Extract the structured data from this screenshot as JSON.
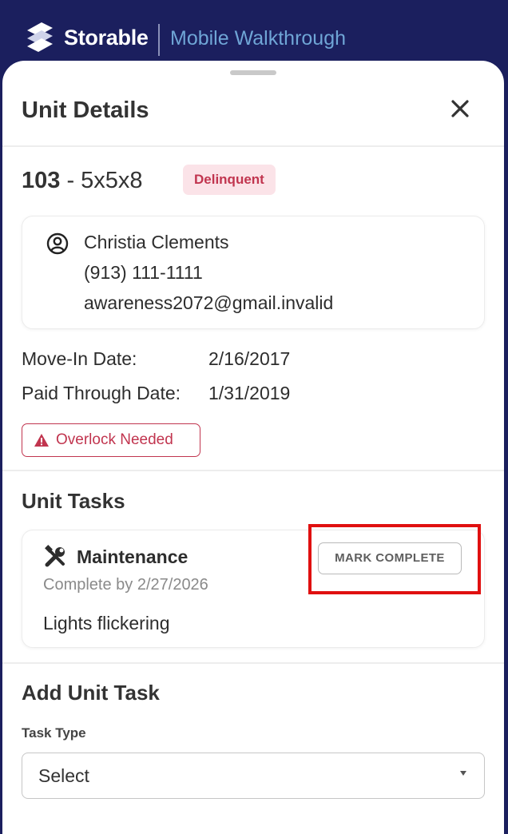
{
  "header": {
    "brand": "Storable",
    "subtitle": "Mobile Walkthrough"
  },
  "sheet": {
    "title": "Unit Details",
    "close_icon": "close-icon",
    "unit": {
      "number": "103",
      "separator": " - ",
      "size": "5x5x8",
      "status": "Delinquent"
    },
    "tenant": {
      "icon": "person-circle-icon",
      "name": "Christia Clements",
      "phone": "(913) 111-1111",
      "email": "awareness2072@gmail.invalid"
    },
    "details": [
      {
        "label": "Move-In Date:",
        "value": "2/16/2017"
      },
      {
        "label": "Paid Through Date:",
        "value": "1/31/2019"
      }
    ],
    "alert": {
      "icon": "warning-icon",
      "label": "Overlock Needed"
    },
    "unit_tasks": {
      "title": "Unit Tasks",
      "items": [
        {
          "icon": "tools-icon",
          "type": "Maintenance",
          "due": "Complete by 2/27/2026",
          "description": "Lights flickering",
          "action_label": "MARK COMPLETE"
        }
      ]
    },
    "add_task": {
      "title": "Add Unit Task",
      "field_label": "Task Type",
      "select_value": "Select"
    }
  },
  "colors": {
    "header_bg": "#1b1f5e",
    "alert_red": "#c1354f",
    "highlight": "#e01010"
  }
}
